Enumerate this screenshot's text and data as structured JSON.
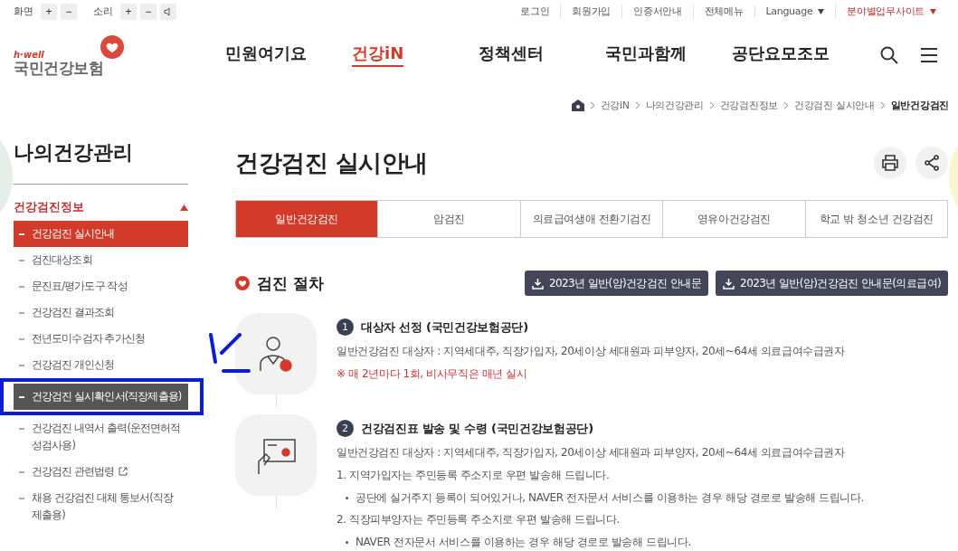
{
  "utility": {
    "screen": {
      "label": "화면",
      "buttons": [
        "+",
        "−"
      ]
    },
    "sound": {
      "label": "소리",
      "buttons": [
        "+",
        "−"
      ]
    },
    "links": [
      {
        "label": "로그인",
        "accent": false,
        "dropdown": false
      },
      {
        "label": "회원가입",
        "accent": false,
        "dropdown": false
      },
      {
        "label": "인증서안내",
        "accent": false,
        "dropdown": false
      },
      {
        "label": "전체메뉴",
        "accent": false,
        "dropdown": false
      },
      {
        "label": "Language",
        "accent": false,
        "dropdown": true
      },
      {
        "label": "분야별업무사이트",
        "accent": true,
        "dropdown": true
      }
    ]
  },
  "logo": {
    "tagline": "h·well",
    "name": "국민건강보험"
  },
  "nav": [
    {
      "label": "민원여기요",
      "selected": false
    },
    {
      "label": "건강iN",
      "selected": true
    },
    {
      "label": "정책센터",
      "selected": false
    },
    {
      "label": "국민과함께",
      "selected": false
    },
    {
      "label": "공단요모조모",
      "selected": false
    }
  ],
  "breadcrumb": [
    "건강iN",
    "나의건강관리",
    "건강검진정보",
    "건강검진 실시안내",
    "일반건강검진"
  ],
  "sidebar": {
    "title": "나의건강관리",
    "group": {
      "label": "건강검진정보",
      "expanded": true
    },
    "items": [
      {
        "label": "건강검진 실시안내",
        "selected": true,
        "focused": false,
        "external": false
      },
      {
        "label": "검진대상조회",
        "selected": false,
        "focused": false,
        "external": false
      },
      {
        "label": "문진표/평가도구 작성",
        "selected": false,
        "focused": false,
        "external": false
      },
      {
        "label": "건강검진 결과조회",
        "selected": false,
        "focused": false,
        "external": false
      },
      {
        "label": "전년도미수검자 추가신청",
        "selected": false,
        "focused": false,
        "external": false
      },
      {
        "label": "건강검진 개인신청",
        "selected": false,
        "focused": false,
        "external": false
      },
      {
        "label": "건강검진 실시확인서(직장제출용)",
        "selected": false,
        "focused": true,
        "external": false
      },
      {
        "label": "건강검진 내역서 출력(운전면허적성검사용)",
        "selected": false,
        "focused": false,
        "external": false
      },
      {
        "label": "건강검진 관련법령",
        "selected": false,
        "focused": false,
        "external": true
      },
      {
        "label": "채용 건강검진 대체 통보서(직장제출용)",
        "selected": false,
        "focused": false,
        "external": false
      }
    ]
  },
  "page": {
    "title": "건강검진 실시안내"
  },
  "tabs": [
    {
      "label": "일반건강검진",
      "selected": true
    },
    {
      "label": "암검진",
      "selected": false
    },
    {
      "label": "의료급여생애 전환기검진",
      "selected": false
    },
    {
      "label": "영유아건강검진",
      "selected": false
    },
    {
      "label": "학교 밖 청소년 건강검진",
      "selected": false
    }
  ],
  "section": {
    "title": "검진 절차",
    "downloads": [
      "2023년 일반(암)건강검진 안내문",
      "2023년 일반(암)건강검진 안내문(의료급여)"
    ]
  },
  "steps": [
    {
      "number": "1",
      "title": "대상자 선정 (국민건강보험공단)",
      "lines": [
        {
          "kind": "text",
          "text": "일반건강검진 대상자 : 지역세대주, 직장가입자, 20세이상 세대원과 피부양자, 20세~64세 의료급여수급권자"
        },
        {
          "kind": "note",
          "text": "※ 매 2년마다 1회, 비사무직은 매년 실시"
        }
      ]
    },
    {
      "number": "2",
      "title": "건강검진표 발송 및 수령 (국민건강보험공단)",
      "lines": [
        {
          "kind": "text",
          "text": "일반건강검진 대상자 : 지역세대주, 직장가입자, 20세이상 세대원과 피부양자, 20세~64세 의료급여수급권자"
        },
        {
          "kind": "item",
          "text": "1. 지역가입자는 주민등록 주소지로 우편 발송해 드립니다."
        },
        {
          "kind": "sub",
          "text": "공단에 실거주지 등록이 되어있거나, NAVER 전자문서 서비스를 이용하는 경우 해당 경로로 발송해 드립니다."
        },
        {
          "kind": "item",
          "text": "2. 직장피부양자는 주민등록 주소지로 우편 발송해 드립니다."
        },
        {
          "kind": "sub",
          "text": "NAVER 전자문서 서비스를 이용하는 경우 해당 경로로 발송해 드립니다."
        }
      ]
    }
  ]
}
